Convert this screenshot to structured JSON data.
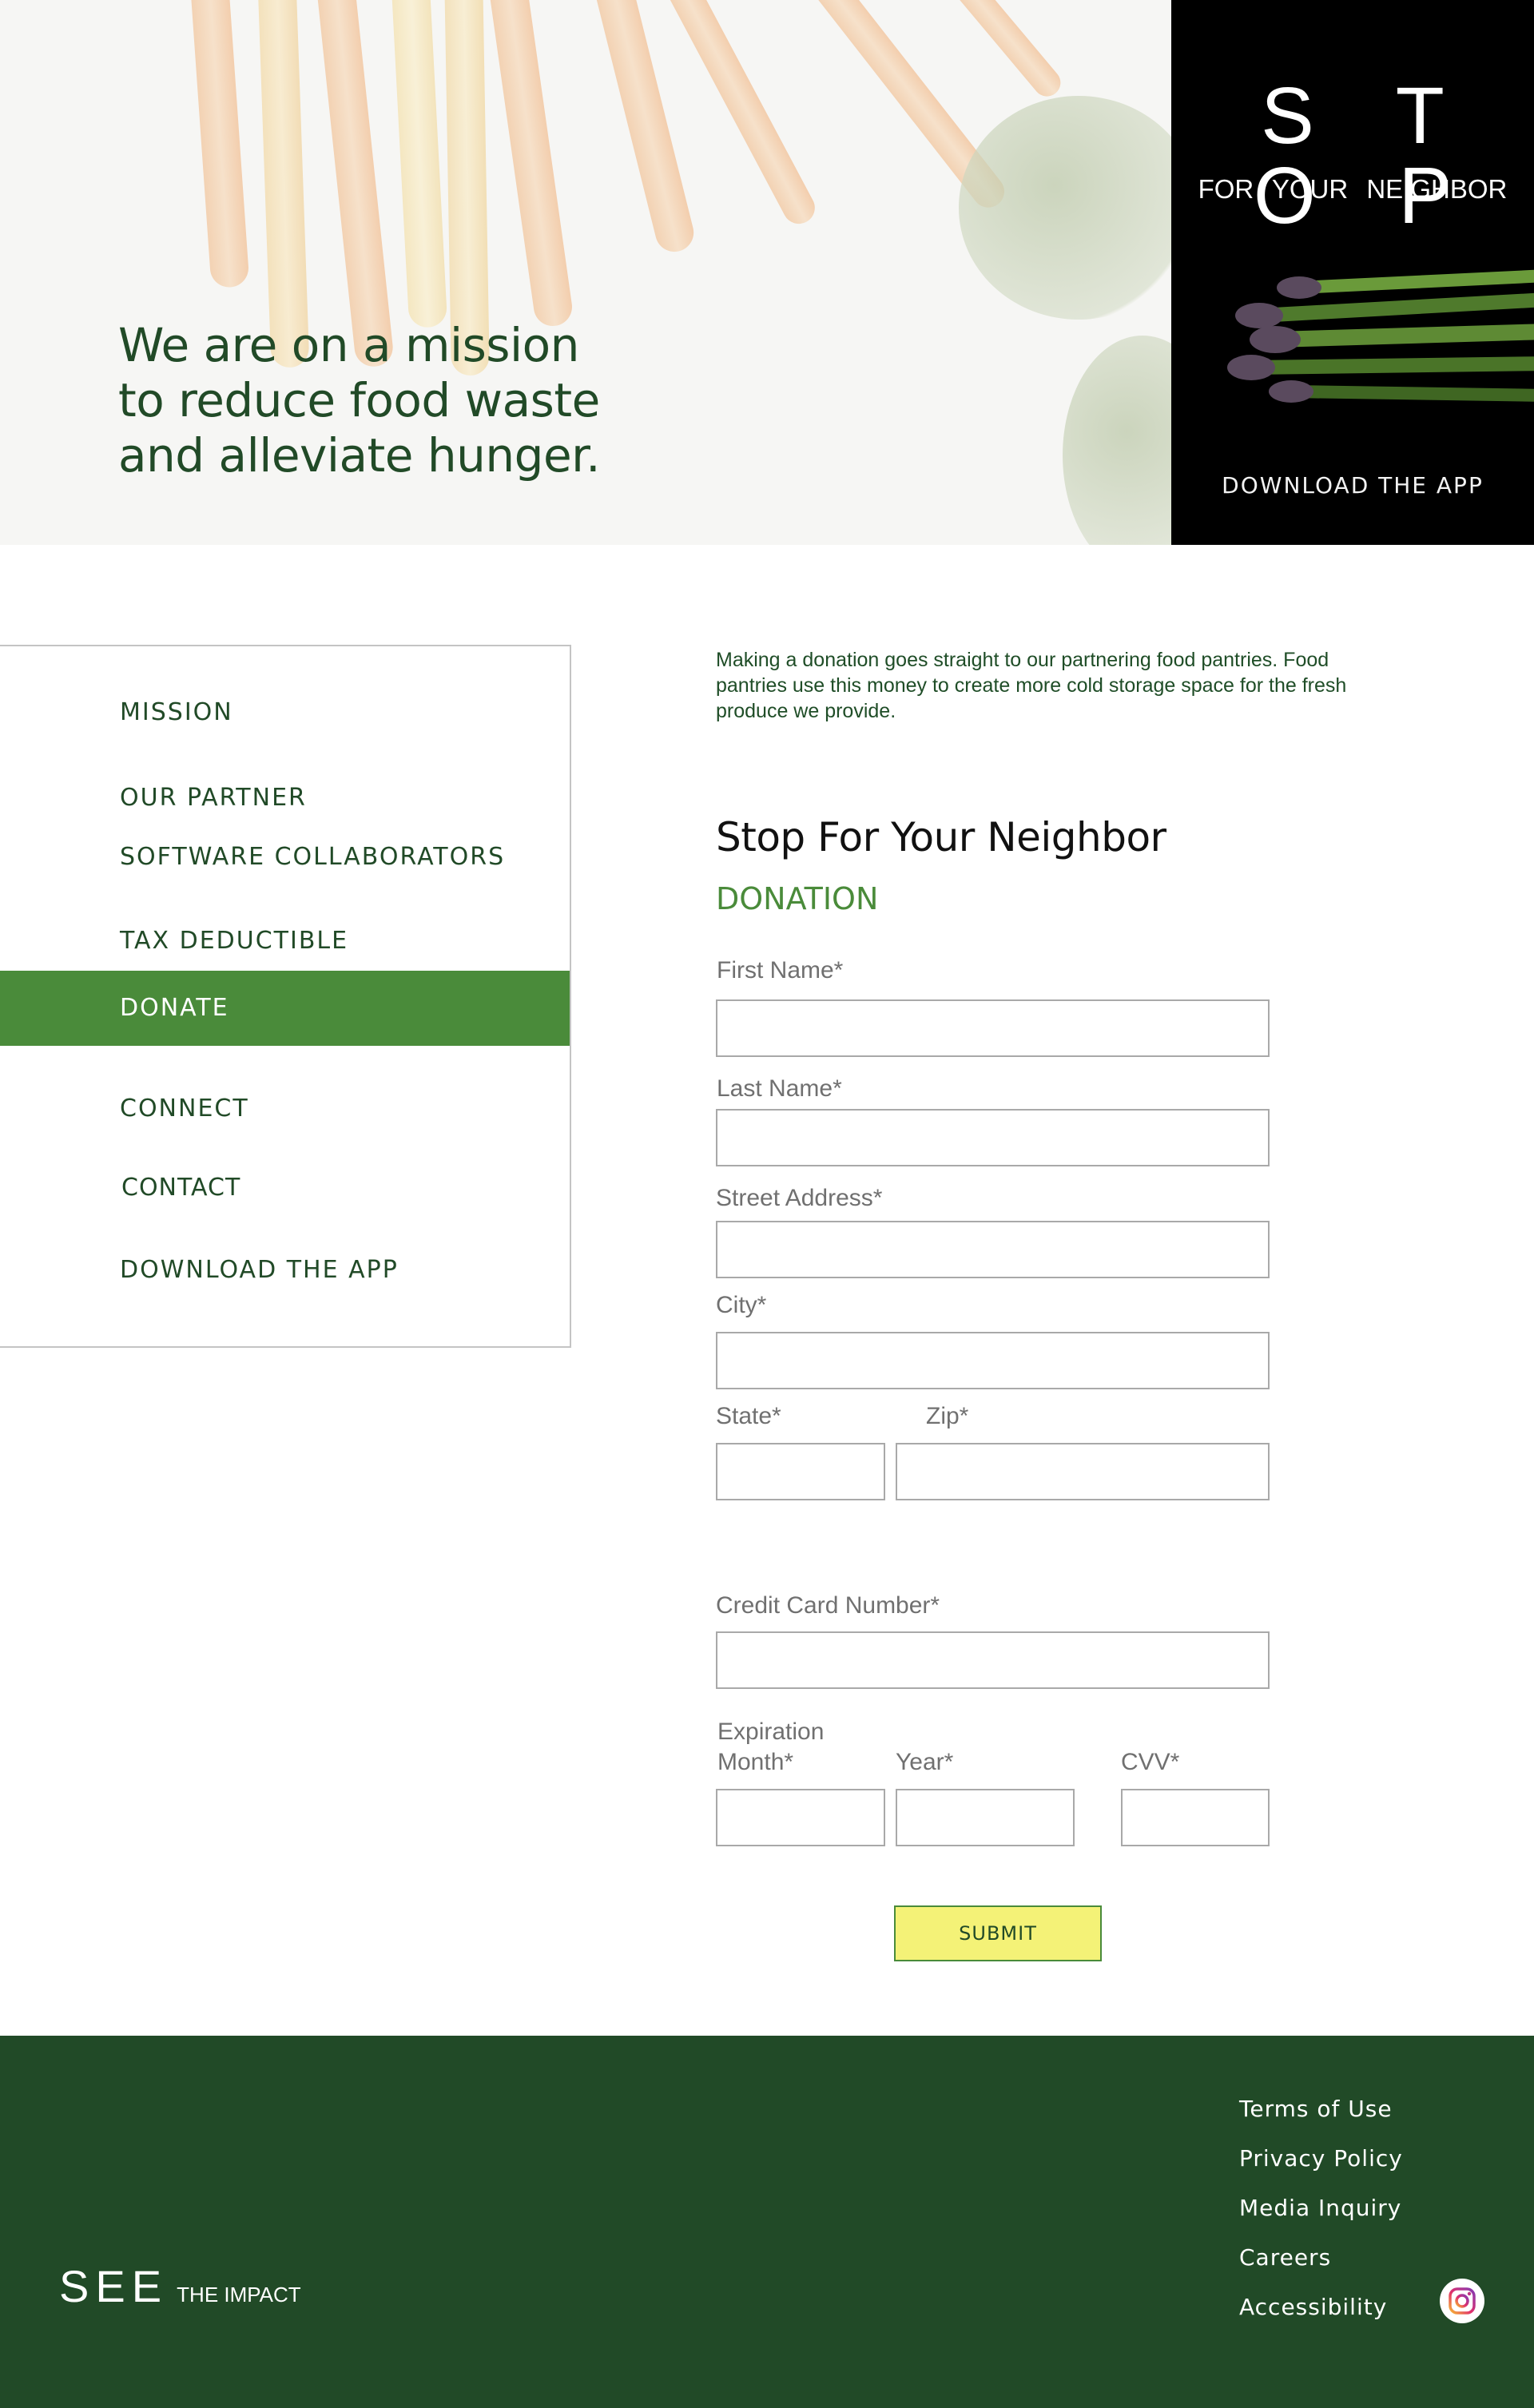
{
  "hero": {
    "headline_lines": [
      "We are on a mission",
      "to reduce food waste",
      "and alleviate hunger."
    ]
  },
  "promo": {
    "title": "S T O P",
    "subtitle": "FOR YOUR NEIGHBOR",
    "cta": "DOWNLOAD THE APP"
  },
  "sidebar": {
    "items": [
      {
        "label": "MISSION",
        "active": false
      },
      {
        "label": "OUR PARTNER",
        "active": false
      },
      {
        "label": "SOFTWARE COLLABORATORS",
        "active": false
      },
      {
        "label": "TAX DEDUCTIBLE",
        "active": false
      },
      {
        "label": "DONATE",
        "active": true
      },
      {
        "label": "CONNECT",
        "active": false
      },
      {
        "label": "CONTACT",
        "active": false
      },
      {
        "label": "DOWNLOAD THE APP",
        "active": false
      }
    ]
  },
  "main": {
    "intro": "Making a donation goes straight to our partnering food pantries. Food pantries use this money to create more cold storage space for the fresh produce we provide.",
    "form_title": "Stop For Your Neighbor",
    "form_subtitle": "DONATION",
    "fields": {
      "first_name": {
        "label": "First Name*",
        "value": ""
      },
      "last_name": {
        "label": "Last Name*",
        "value": ""
      },
      "street": {
        "label": "Street Address*",
        "value": ""
      },
      "city": {
        "label": "City*",
        "value": ""
      },
      "state": {
        "label": "State*",
        "value": ""
      },
      "zip": {
        "label": "Zip*",
        "value": ""
      },
      "card": {
        "label": "Credit Card Number*",
        "value": ""
      },
      "expiration_heading": "Expiration",
      "month": {
        "label": "Month*",
        "value": ""
      },
      "year": {
        "label": "Year*",
        "value": ""
      },
      "cvv": {
        "label": "CVV*",
        "value": ""
      }
    },
    "submit_label": "SUBMIT"
  },
  "footer": {
    "brand_main": "SEE",
    "brand_sub": "THE IMPACT",
    "links": [
      "Terms of Use",
      "Privacy Policy",
      "Media Inquiry",
      "Careers",
      "Accessibility"
    ],
    "social_icon": "instagram-icon"
  },
  "colors": {
    "brand_dark_green": "#214a27",
    "accent_green": "#4a8b3a",
    "submit_yellow": "#f4f277",
    "promo_black": "#000000"
  }
}
